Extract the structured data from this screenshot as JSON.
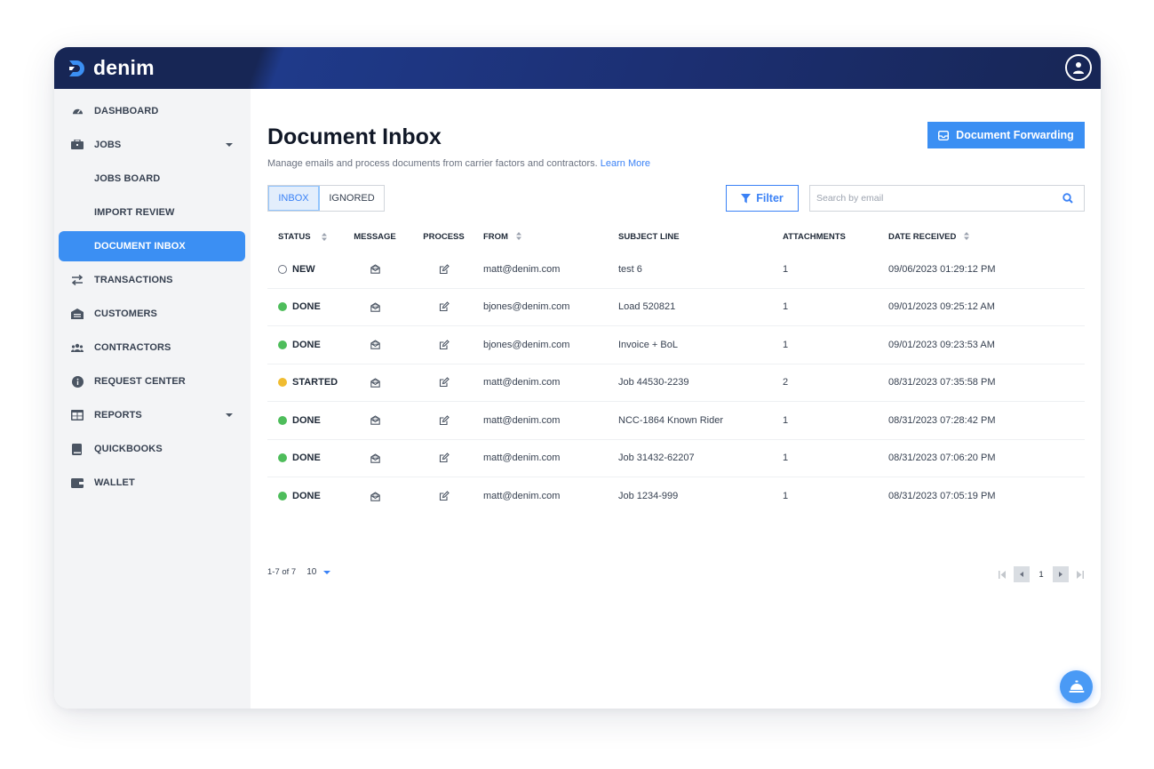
{
  "brand": {
    "name": "denim"
  },
  "sidebar": {
    "items": [
      {
        "label": "DASHBOARD",
        "icon": "dashboard-icon"
      },
      {
        "label": "JOBS",
        "icon": "jobs-icon",
        "expandable": true
      },
      {
        "label": "JOBS BOARD",
        "sub": true
      },
      {
        "label": "IMPORT REVIEW",
        "sub": true
      },
      {
        "label": "DOCUMENT INBOX",
        "sub": true,
        "active": true
      },
      {
        "label": "TRANSACTIONS",
        "icon": "transfer-icon"
      },
      {
        "label": "CUSTOMERS",
        "icon": "warehouse-icon"
      },
      {
        "label": "CONTRACTORS",
        "icon": "users-icon"
      },
      {
        "label": "REQUEST CENTER",
        "icon": "info-icon"
      },
      {
        "label": "REPORTS",
        "icon": "table-icon",
        "expandable": true
      },
      {
        "label": "QUICKBOOKS",
        "icon": "book-icon"
      },
      {
        "label": "WALLET",
        "icon": "wallet-icon"
      }
    ]
  },
  "header": {
    "title": "Document Inbox",
    "subtitle": "Manage emails and process documents from carrier factors and contractors.",
    "learn_more": "Learn More",
    "forward_button": "Document Forwarding"
  },
  "tabs": {
    "inbox": "INBOX",
    "ignored": "IGNORED"
  },
  "filter": {
    "label": "Filter"
  },
  "search": {
    "placeholder": "Search by email",
    "value": ""
  },
  "table": {
    "columns": {
      "status": "STATUS",
      "message": "MESSAGE",
      "process": "PROCESS",
      "from": "FROM",
      "subject": "SUBJECT LINE",
      "attachments": "ATTACHMENTS",
      "date": "DATE RECEIVED"
    },
    "rows": [
      {
        "status": "NEW",
        "from": "matt@denim.com",
        "subject": "test 6",
        "attachments": "1",
        "date": "09/06/2023 01:29:12 PM"
      },
      {
        "status": "DONE",
        "from": "bjones@denim.com",
        "subject": "Load 520821",
        "attachments": "1",
        "date": "09/01/2023 09:25:12 AM"
      },
      {
        "status": "DONE",
        "from": "bjones@denim.com",
        "subject": "Invoice + BoL",
        "attachments": "1",
        "date": "09/01/2023 09:23:53 AM"
      },
      {
        "status": "STARTED",
        "from": "matt@denim.com",
        "subject": "Job 44530-2239",
        "attachments": "2",
        "date": "08/31/2023 07:35:58 PM"
      },
      {
        "status": "DONE",
        "from": "matt@denim.com",
        "subject": "NCC-1864 Known Rider",
        "attachments": "1",
        "date": "08/31/2023 07:28:42 PM"
      },
      {
        "status": "DONE",
        "from": "matt@denim.com",
        "subject": "Job 31432-62207",
        "attachments": "1",
        "date": "08/31/2023 07:06:20 PM"
      },
      {
        "status": "DONE",
        "from": "matt@denim.com",
        "subject": "Job 1234-999",
        "attachments": "1",
        "date": "08/31/2023 07:05:19 PM"
      }
    ]
  },
  "pagination": {
    "range": "1-7 of 7",
    "per_page": "10",
    "current_page": "1"
  },
  "colors": {
    "brand_navy": "#172655",
    "accent": "#3b8ff3",
    "done": "#4ebd5b",
    "started": "#f0bc31"
  }
}
